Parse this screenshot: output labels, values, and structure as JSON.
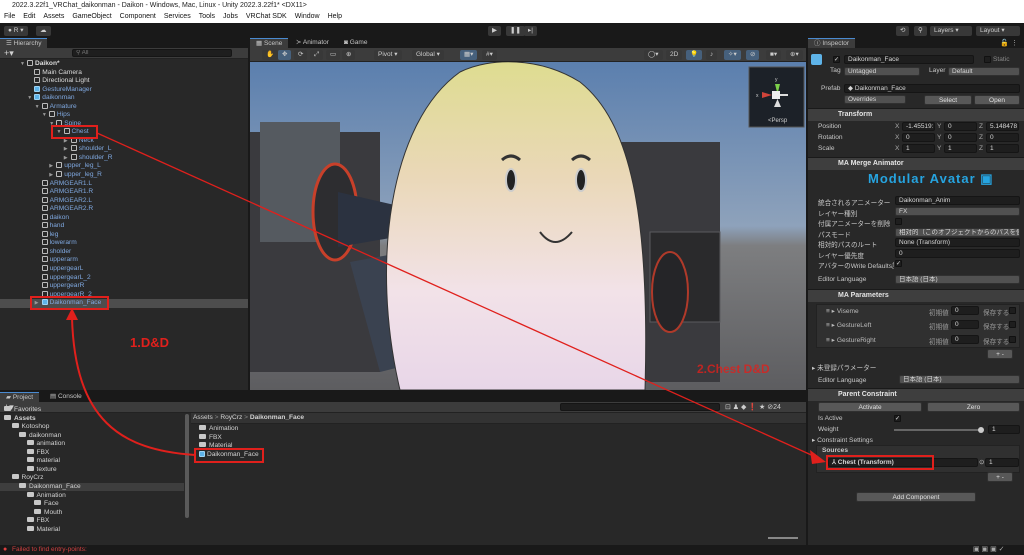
{
  "window": {
    "title": "2022.3.22f1_VRChat_daikonman - Daikon - Windows, Mac, Linux - Unity 2022.3.22f1* <DX11>"
  },
  "menu": [
    "File",
    "Edit",
    "Assets",
    "GameObject",
    "Component",
    "Services",
    "Tools",
    "Jobs",
    "VRChat SDK",
    "Window",
    "Help"
  ],
  "toolbar": {
    "account": "R",
    "layers": "Layers",
    "layout": "Layout"
  },
  "hierarchy": {
    "tab": "Hierarchy",
    "search_placeholder": "All",
    "items": [
      {
        "label": "Daikon*",
        "depth": 0,
        "arrow": "open",
        "kind": "scene"
      },
      {
        "label": "Main Camera",
        "depth": 1,
        "kind": "obj"
      },
      {
        "label": "Directional Light",
        "depth": 1,
        "kind": "obj"
      },
      {
        "label": "GestureManager",
        "depth": 1,
        "kind": "prefab"
      },
      {
        "label": "daikonman",
        "depth": 1,
        "arrow": "open",
        "kind": "prefab"
      },
      {
        "label": "Armature",
        "depth": 2,
        "arrow": "open",
        "kind": "pobj"
      },
      {
        "label": "Hips",
        "depth": 3,
        "arrow": "open",
        "kind": "pobj"
      },
      {
        "label": "Spine",
        "depth": 4,
        "arrow": "open",
        "kind": "pobj"
      },
      {
        "label": "Chest",
        "depth": 5,
        "arrow": "open",
        "kind": "pobj"
      },
      {
        "label": "Neck",
        "depth": 6,
        "arrow": "closed",
        "kind": "pobj"
      },
      {
        "label": "shoulder_L",
        "depth": 6,
        "arrow": "closed",
        "kind": "pobj"
      },
      {
        "label": "shoulder_R",
        "depth": 6,
        "arrow": "closed",
        "kind": "pobj"
      },
      {
        "label": "upper_leg_L",
        "depth": 4,
        "arrow": "closed",
        "kind": "pobj"
      },
      {
        "label": "upper_leg_R",
        "depth": 4,
        "arrow": "closed",
        "kind": "pobj"
      },
      {
        "label": "ARMGEAR1.L",
        "depth": 2,
        "kind": "pobj"
      },
      {
        "label": "ARMGEAR1.R",
        "depth": 2,
        "kind": "pobj"
      },
      {
        "label": "ARMGEAR2.L",
        "depth": 2,
        "kind": "pobj"
      },
      {
        "label": "ARMGEAR2.R",
        "depth": 2,
        "kind": "pobj"
      },
      {
        "label": "daikon",
        "depth": 2,
        "kind": "pobj"
      },
      {
        "label": "hand",
        "depth": 2,
        "kind": "pobj"
      },
      {
        "label": "leg",
        "depth": 2,
        "kind": "pobj"
      },
      {
        "label": "lowerarm",
        "depth": 2,
        "kind": "pobj"
      },
      {
        "label": "sholder",
        "depth": 2,
        "kind": "pobj"
      },
      {
        "label": "upperarm",
        "depth": 2,
        "kind": "pobj"
      },
      {
        "label": "uppergearL",
        "depth": 2,
        "kind": "pobj"
      },
      {
        "label": "uppergearL_2",
        "depth": 2,
        "kind": "pobj"
      },
      {
        "label": "uppergearR",
        "depth": 2,
        "kind": "pobj"
      },
      {
        "label": "uppergearR_2",
        "depth": 2,
        "kind": "pobj"
      },
      {
        "label": "Daikonman_Face",
        "depth": 2,
        "arrow": "closed",
        "kind": "prefab",
        "selected": true
      }
    ]
  },
  "scene": {
    "tabs": [
      "Scene",
      "Animator",
      "Game"
    ],
    "pivot": "Pivot",
    "global": "Global",
    "mode_2d": "2D",
    "gizmo_label": "Persp",
    "axis_y": "y",
    "axis_x": "x"
  },
  "annotations": {
    "step1": "1.D&D",
    "step2": "2.Chest D&D",
    "color": "#e0201c"
  },
  "inspector": {
    "tab": "Inspector",
    "name": "Daikonman_Face",
    "static": "Static",
    "tag_label": "Tag",
    "tag": "Untagged",
    "layer_label": "Layer",
    "layer": "Default",
    "prefab_label": "Prefab",
    "prefab": "Daikonman_Face",
    "overrides": "Overrides",
    "select": "Select",
    "open": "Open",
    "transform": {
      "title": "Transform",
      "position": "Position",
      "rotation": "Rotation",
      "scale": "Scale",
      "pos": [
        "-1.45519:",
        "0",
        "5.148478"
      ],
      "rot": [
        "0",
        "0",
        "0"
      ],
      "scl": [
        "1",
        "1",
        "1"
      ],
      "axes": [
        "X",
        "Y",
        "Z"
      ]
    },
    "merge": {
      "title": "MA Merge Animator",
      "logo": "Modular Avatar",
      "rows": [
        {
          "label": "統合されるアニメーター",
          "value": "Daikonman_Anim"
        },
        {
          "label": "レイヤー種別",
          "value": "FX"
        },
        {
          "label": "付属アニメーターを削除",
          "value": ""
        },
        {
          "label": "パスモード",
          "value": "相対的（このオブジェクトからのパスを使用）"
        },
        {
          "label": "相対的パスのルート",
          "value": "None (Transform)"
        },
        {
          "label": "レイヤー優先度",
          "value": "0"
        },
        {
          "label": "アバターのWrite Defaults設定",
          "value": ""
        }
      ],
      "lang_label": "Editor Language",
      "lang": "日本語 (日本)"
    },
    "params": {
      "title": "MA Parameters",
      "init_label": "初期値",
      "save_label": "保存する",
      "items": [
        {
          "name": "Viseme",
          "value": "0"
        },
        {
          "name": "GestureLeft",
          "value": "0"
        },
        {
          "name": "GestureRight",
          "value": "0"
        }
      ],
      "unregistered": "未登録パラメーター",
      "lang_label": "Editor Language",
      "lang": "日本語 (日本)"
    },
    "constraint": {
      "title": "Parent Constraint",
      "activate": "Activate",
      "zero": "Zero",
      "is_active": "Is Active",
      "weight_label": "Weight",
      "weight": "1",
      "weight_fraction": 1.0,
      "settings": "Constraint Settings",
      "sources": "Sources",
      "source": "Chest (Transform)",
      "source_weight": "1"
    },
    "add_component": "Add Component"
  },
  "project": {
    "tabs": [
      "Project",
      "Console"
    ],
    "tree": [
      {
        "label": "Favorites",
        "depth": 0
      },
      {
        "label": "Assets",
        "depth": 0,
        "bold": true
      },
      {
        "label": "Kotoshop",
        "depth": 1
      },
      {
        "label": "daikonman",
        "depth": 2
      },
      {
        "label": "animation",
        "depth": 3
      },
      {
        "label": "FBX",
        "depth": 3
      },
      {
        "label": "material",
        "depth": 3
      },
      {
        "label": "texture",
        "depth": 3
      },
      {
        "label": "RoyCrz",
        "depth": 1
      },
      {
        "label": "Daikonman_Face",
        "depth": 2,
        "selected": true
      },
      {
        "label": "Animation",
        "depth": 3
      },
      {
        "label": "Face",
        "depth": 4
      },
      {
        "label": "Mouth",
        "depth": 4
      },
      {
        "label": "FBX",
        "depth": 3
      },
      {
        "label": "Material",
        "depth": 3
      }
    ],
    "breadcrumb": [
      "Assets",
      "RoyCrz",
      "Daikonman_Face"
    ],
    "files": [
      {
        "label": "Animation",
        "kind": "folder"
      },
      {
        "label": "FBX",
        "kind": "folder"
      },
      {
        "label": "Material",
        "kind": "folder"
      },
      {
        "label": "Daikonman_Face",
        "kind": "prefab"
      }
    ],
    "hidden_count": "24"
  },
  "status": {
    "error": "Failed to find entry-points:"
  }
}
